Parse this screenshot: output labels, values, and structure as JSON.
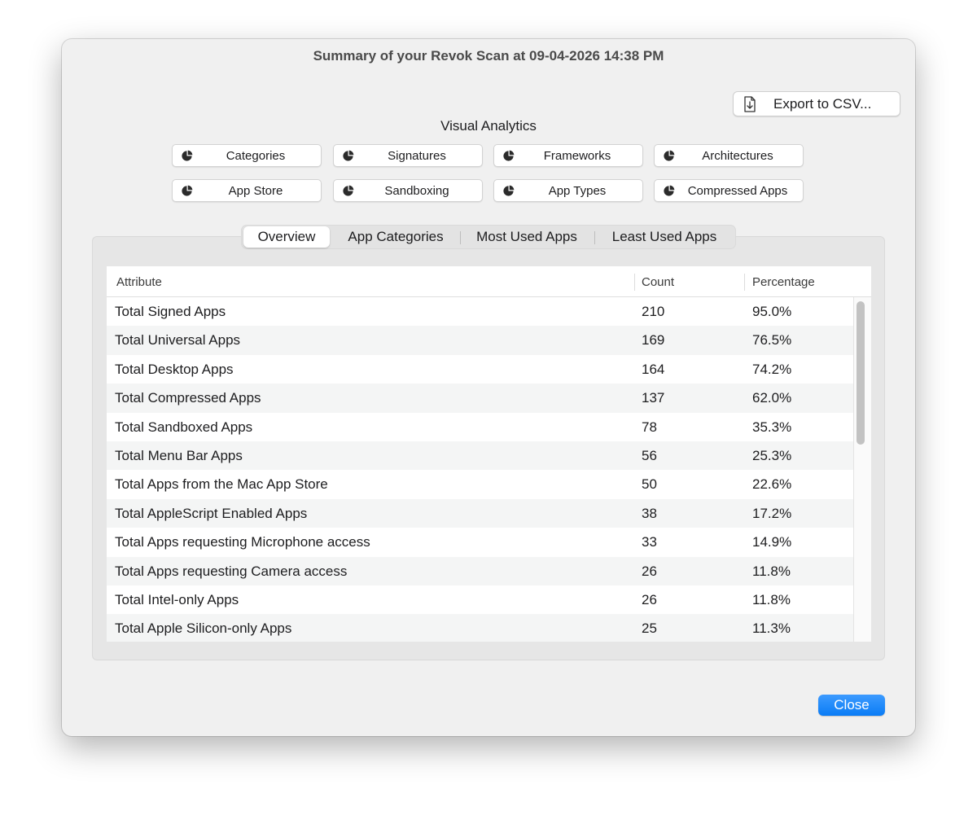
{
  "window": {
    "title": "Summary of your Revok Scan at 09-04-2026 14:38 PM"
  },
  "export_button": {
    "label": "Export to CSV...",
    "icon": "document-download-icon"
  },
  "visual_analytics": {
    "title": "Visual Analytics",
    "buttons": [
      {
        "label": "Categories",
        "icon": "pie-chart-icon"
      },
      {
        "label": "Signatures",
        "icon": "pie-chart-icon"
      },
      {
        "label": "Frameworks",
        "icon": "pie-chart-icon"
      },
      {
        "label": "Architectures",
        "icon": "pie-chart-icon"
      },
      {
        "label": "App Store",
        "icon": "pie-chart-icon"
      },
      {
        "label": "Sandboxing",
        "icon": "pie-chart-icon"
      },
      {
        "label": "App Types",
        "icon": "pie-chart-icon"
      },
      {
        "label": "Compressed Apps",
        "icon": "pie-chart-icon"
      }
    ]
  },
  "tabs": [
    {
      "label": "Overview",
      "selected": true
    },
    {
      "label": "App Categories",
      "selected": false
    },
    {
      "label": "Most Used Apps",
      "selected": false
    },
    {
      "label": "Least Used Apps",
      "selected": false
    }
  ],
  "table": {
    "columns": [
      "Attribute",
      "Count",
      "Percentage"
    ],
    "rows": [
      {
        "attribute": "Total Signed Apps",
        "count": "210",
        "percentage": "95.0%"
      },
      {
        "attribute": "Total Universal Apps",
        "count": "169",
        "percentage": "76.5%"
      },
      {
        "attribute": "Total Desktop Apps",
        "count": "164",
        "percentage": "74.2%"
      },
      {
        "attribute": "Total Compressed Apps",
        "count": "137",
        "percentage": "62.0%"
      },
      {
        "attribute": "Total Sandboxed Apps",
        "count": "78",
        "percentage": "35.3%"
      },
      {
        "attribute": "Total Menu Bar Apps",
        "count": "56",
        "percentage": "25.3%"
      },
      {
        "attribute": "Total Apps from the Mac App Store",
        "count": "50",
        "percentage": "22.6%"
      },
      {
        "attribute": "Total AppleScript Enabled Apps",
        "count": "38",
        "percentage": "17.2%"
      },
      {
        "attribute": "Total Apps requesting Microphone access",
        "count": "33",
        "percentage": "14.9%"
      },
      {
        "attribute": "Total Apps requesting Camera access",
        "count": "26",
        "percentage": "11.8%"
      },
      {
        "attribute": "Total Intel-only Apps",
        "count": "26",
        "percentage": "11.8%"
      },
      {
        "attribute": "Total Apple Silicon-only Apps",
        "count": "25",
        "percentage": "11.3%"
      }
    ]
  },
  "close_button": {
    "label": "Close"
  },
  "colors": {
    "accent": "#0a7cf5",
    "window_bg": "#f0f0f0",
    "row_alt": "#f4f5f5"
  }
}
